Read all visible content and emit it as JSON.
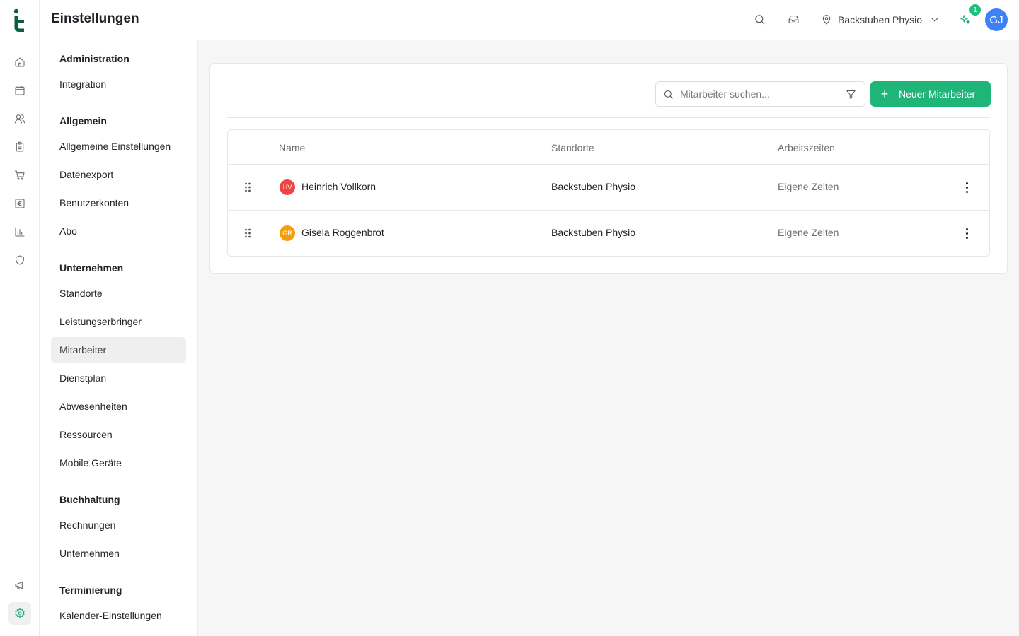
{
  "header": {
    "title": "Einstellungen",
    "location": "Backstuben Physio",
    "notification_count": "1",
    "user_initials": "GJ"
  },
  "rail": {
    "icons": [
      "home-icon",
      "calendar-icon",
      "users-icon",
      "clipboard-icon",
      "cart-icon",
      "euro-icon",
      "chart-icon",
      "shield-icon",
      "megaphone-icon",
      "settings-icon"
    ]
  },
  "settings_nav": {
    "groups": [
      {
        "label": "Administration",
        "items": [
          "Integration"
        ]
      },
      {
        "label": "Allgemein",
        "items": [
          "Allgemeine Einstellungen",
          "Datenexport",
          "Benutzerkonten",
          "Abo"
        ]
      },
      {
        "label": "Unternehmen",
        "items": [
          "Standorte",
          "Leistungserbringer",
          "Mitarbeiter",
          "Dienstplan",
          "Abwesenheiten",
          "Ressourcen",
          "Mobile Geräte"
        ]
      },
      {
        "label": "Buchhaltung",
        "items": [
          "Rechnungen",
          "Unternehmen"
        ]
      },
      {
        "label": "Terminierung",
        "items": [
          "Kalender-Einstellungen"
        ]
      }
    ],
    "active": "Mitarbeiter"
  },
  "toolbar": {
    "search_placeholder": "Mitarbeiter suchen...",
    "new_button": "Neuer Mitarbeiter"
  },
  "table": {
    "columns": [
      "Name",
      "Standorte",
      "Arbeitszeiten"
    ],
    "rows": [
      {
        "initials": "HV",
        "name": "Heinrich Vollkorn",
        "location": "Backstuben Physio",
        "hours": "Eigene Zeiten",
        "color": "#ef4444"
      },
      {
        "initials": "GR",
        "name": "Gisela Roggenbrot",
        "location": "Backstuben Physio",
        "hours": "Eigene Zeiten",
        "color": "#f59e0b"
      }
    ]
  },
  "colors": {
    "accent": "#1fb578",
    "logo": "#0f5c45",
    "avatar": "#3b82f6"
  }
}
